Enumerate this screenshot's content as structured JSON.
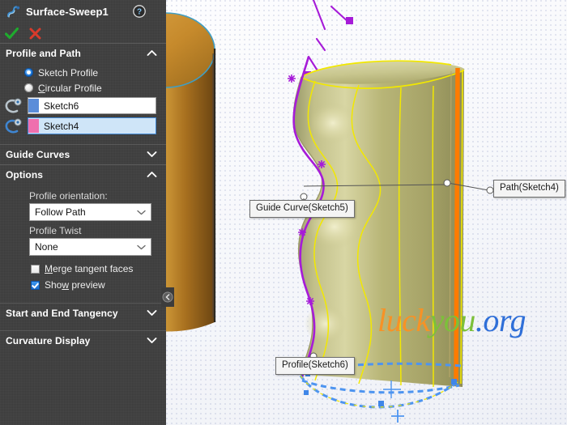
{
  "panel": {
    "title": "Surface-Sweep1",
    "feature_icon": "sweep-icon",
    "help_icon": "help-icon",
    "confirm": {
      "ok_icon": "checkmark-icon",
      "cancel_icon": "cross-icon"
    },
    "sections": [
      {
        "id": "profile-and-path",
        "title": "Profile and Path",
        "expanded": true,
        "chevron": "chevron-up-icon"
      },
      {
        "id": "guide-curves",
        "title": "Guide Curves",
        "expanded": false,
        "chevron": "chevron-down-icon"
      },
      {
        "id": "options",
        "title": "Options",
        "expanded": true,
        "chevron": "chevron-up-icon"
      },
      {
        "id": "start-and-end-tangency",
        "title": "Start and End Tangency",
        "expanded": false,
        "chevron": "chevron-down-icon"
      },
      {
        "id": "curvature-display",
        "title": "Curvature Display",
        "expanded": false,
        "chevron": "chevron-down-icon"
      }
    ],
    "profile_and_path": {
      "radios": [
        {
          "label": "Sketch Profile",
          "selected": true
        },
        {
          "label": "Circular Profile",
          "selected": false
        }
      ],
      "profile_field": {
        "value": "Sketch6",
        "swatch_color": "#5b8dd9",
        "focused": false,
        "icon": "profile-selection-icon"
      },
      "path_field": {
        "value": "Sketch4",
        "swatch_color": "#ef6fae",
        "focused": true,
        "icon": "path-selection-icon"
      }
    },
    "options": {
      "profile_orientation": {
        "label": "Profile orientation:",
        "value": "Follow Path",
        "arrow": "chevron-down-icon"
      },
      "profile_twist": {
        "label": "Profile Twist",
        "value": "None",
        "arrow": "chevron-down-icon"
      },
      "merge_tangent_faces": {
        "label": "Merge tangent faces",
        "checked": false
      },
      "show_preview": {
        "label": "Show preview",
        "checked": true
      }
    },
    "splitter_icon": "splitter-grip-icon"
  },
  "viewport": {
    "callouts": [
      {
        "id": "guide-curve",
        "text": "Guide Curve(Sketch5)"
      },
      {
        "id": "path",
        "text": "Path(Sketch4)"
      },
      {
        "id": "profile",
        "text": "Profile(Sketch6)"
      }
    ],
    "watermark": {
      "part1": "luck",
      "part2": "you",
      "part3": ".",
      "part4": "org",
      "color1": "#f79226",
      "color2": "#7cc03a",
      "color3": "#2f6fd8"
    },
    "colors": {
      "cylinder": "#c08a2e",
      "surface": "#b5b272",
      "edge_yellow": "#f2e800",
      "guide_purple": "#a61bd8",
      "path_orange": "#ff7b00",
      "selection_blue": "#4d94f0"
    }
  }
}
